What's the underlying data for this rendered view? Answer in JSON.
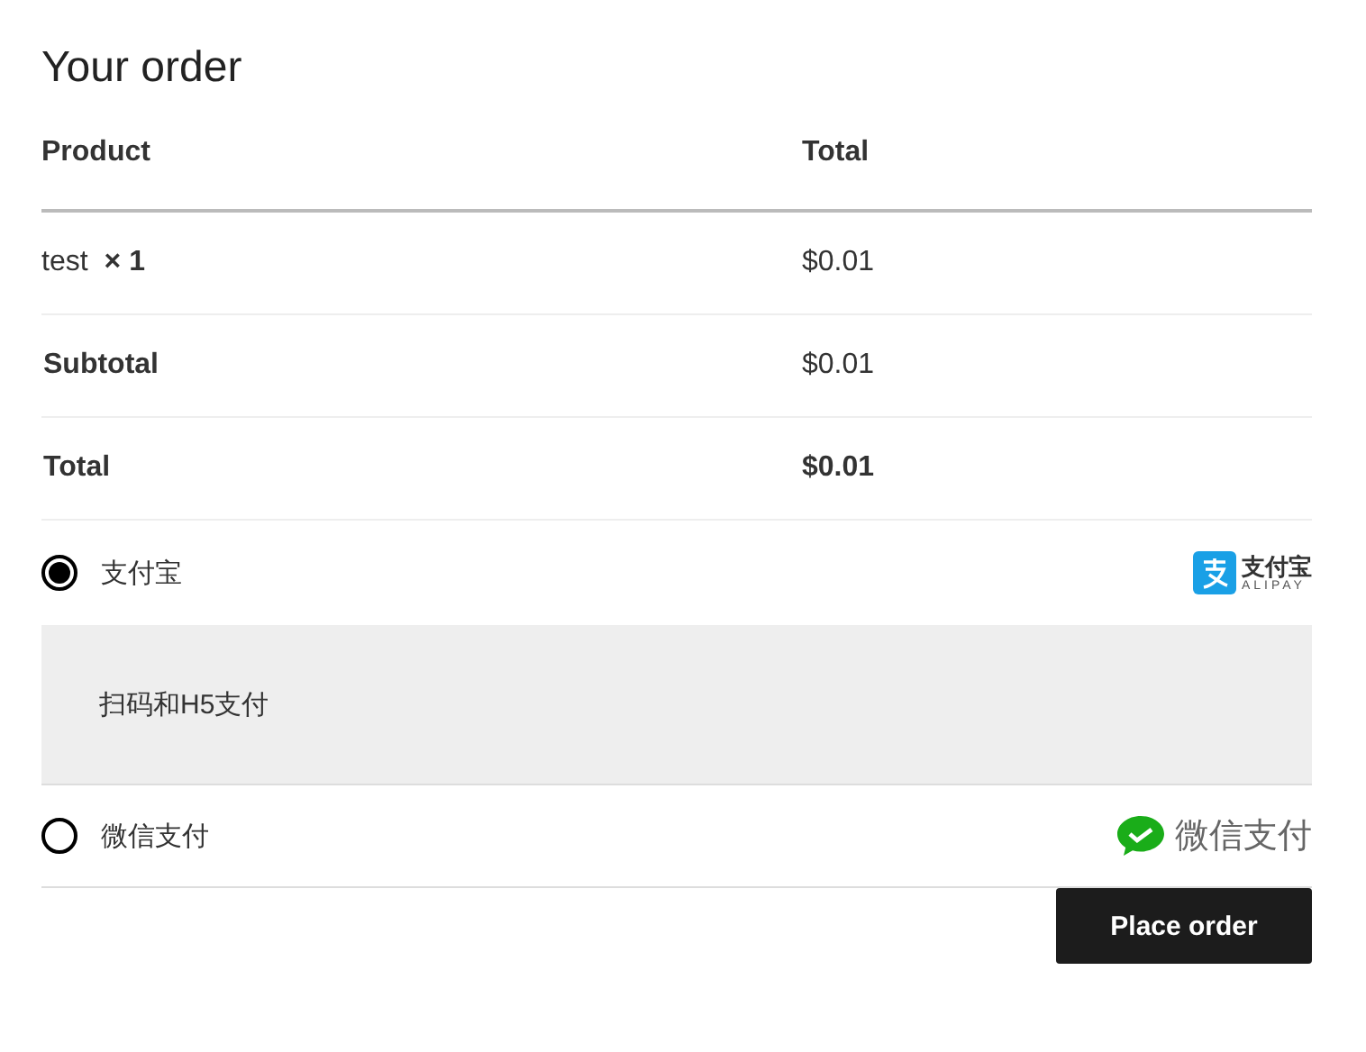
{
  "title": "Your order",
  "table": {
    "columns": [
      "Product",
      "Total"
    ],
    "items": [
      {
        "product": "test",
        "quantity": "× 1",
        "total": "$0.01"
      }
    ],
    "totals": [
      {
        "label": "Subtotal",
        "value": "$0.01",
        "kind": "subtotal"
      },
      {
        "label": "Total",
        "value": "$0.01",
        "kind": "total"
      }
    ]
  },
  "payment_methods": [
    {
      "label": "支付宝",
      "selected": true,
      "kind": "alipay",
      "logo_text": "支付宝",
      "logo_subtext": "ALIPAY",
      "description": "扫码和H5支付"
    },
    {
      "label": "微信支付",
      "selected": false,
      "kind": "wechat",
      "logo_text": "微信支付"
    }
  ],
  "button": "Place order"
}
